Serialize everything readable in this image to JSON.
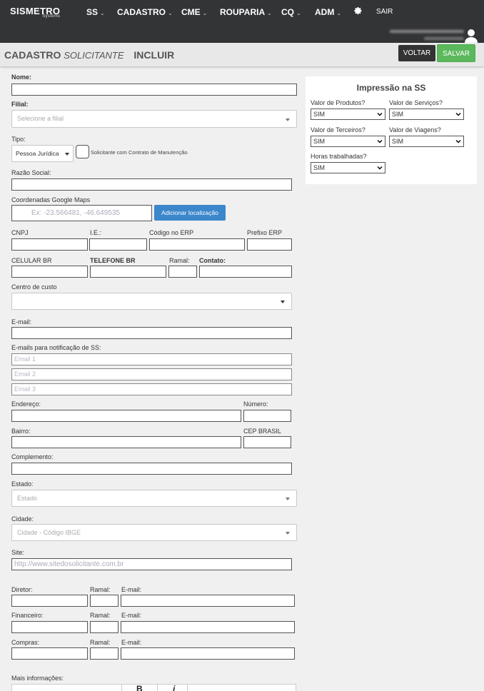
{
  "brand": {
    "name": "SISMETRO",
    "sub": "Systems"
  },
  "nav": {
    "items": [
      {
        "label": "SS",
        "chev": "⌄"
      },
      {
        "label": "CADASTRO",
        "chev": "⌄"
      },
      {
        "label": "CME",
        "chev": "⌄"
      },
      {
        "label": "ROUPARIA",
        "chev": "⌄"
      },
      {
        "label": "CQ",
        "chev": "⌄"
      },
      {
        "label": "ADM",
        "chev": "⌄"
      }
    ],
    "logout": "SAIR"
  },
  "header": {
    "title": "CADASTRO",
    "subtitle": "SOLICITANTE",
    "mode": "INCLUIR",
    "back_label": "VOLTAR",
    "save_label": "SALVAR"
  },
  "form": {
    "nome_label": "Nome:",
    "filial_label": "Filial:",
    "filial_placeholder": "Selecione a filial",
    "tipo_label": "Tipo:",
    "tipo_value": "Pessoa Jurídica",
    "contrato_label": "Solicitante com Contrato de Manutenção",
    "razao_label": "Razão Social:",
    "coords_label": "Coordenadas Google Maps",
    "coords_placeholder": "Ex: -23.566481, -46.649535",
    "add_location": "Adicionar localização",
    "cnpj_label": "CNPJ",
    "ie_label": "I.E.:",
    "erp_label": "Código no ERP",
    "prefixo_label": "Prefixo ERP",
    "celular_label": "CELULAR BR",
    "telefone_label": "TELEFONE BR",
    "ramal_label": "Ramal:",
    "contato_label": "Contato:",
    "centro_label": "Centro de custo",
    "email_label": "E-mail:",
    "notif_label": "E-mails para notificação de SS:",
    "email1": "Email 1",
    "email2": "Email 2",
    "email3": "Email 3",
    "endereco_label": "Endereço:",
    "numero_label": "Número:",
    "bairro_label": "Bairro:",
    "cep_label": "CEP BRASIL",
    "complemento_label": "Complemento:",
    "estado_label": "Estado:",
    "estado_placeholder": "Estado",
    "cidade_label": "Cidade:",
    "cidade_placeholder": "Cidade - Código IBGE",
    "site_label": "Site:",
    "site_placeholder": "http://www.sitedosolicitante.com.br",
    "diretor_label": "Diretor:",
    "financeiro_label": "Financeiro:",
    "compras_label": "Compras:",
    "email_short_label": "E-mail:",
    "mais_label": "Mais informações:"
  },
  "panel": {
    "title": "Impressão na SS",
    "fields": [
      {
        "label": "Valor de Produtos?",
        "value": "SIM"
      },
      {
        "label": "Valor de Serviços?",
        "value": "SIM"
      },
      {
        "label": "Valor de Terceiros?",
        "value": "SIM"
      },
      {
        "label": "Valor de Viagens?",
        "value": "SIM"
      },
      {
        "label": "Horas trabalhadas?",
        "value": "SIM"
      }
    ]
  },
  "editor": {
    "bold": "B",
    "italic": "i"
  }
}
